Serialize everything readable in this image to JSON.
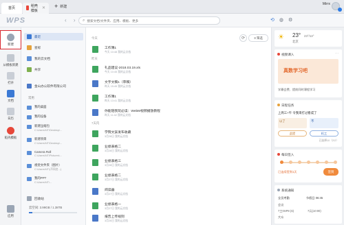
{
  "titlebar": {
    "tabs": [
      {
        "label": "首页"
      },
      {
        "label": "稻壳模板"
      }
    ],
    "new_tab": "新建",
    "user": "Mirrx"
  },
  "header": {
    "logo": "WPS",
    "search_placeholder": "搜索文档/文件夹、应用、模板、更多"
  },
  "rail": [
    {
      "label": "新建",
      "color": "#9aa5b4"
    },
    {
      "label": "从模板新建",
      "color": "#c2c8d0"
    },
    {
      "label": "打开",
      "color": "#c9ced6"
    },
    {
      "label": "文档",
      "color": "#3b79d4"
    },
    {
      "label": "日历",
      "color": "#c9ced6"
    },
    {
      "label": "稻壳模板",
      "color": "#e6473a"
    },
    {
      "label": "应用",
      "color": "#9aa5b4"
    }
  ],
  "sidebar": {
    "items": [
      {
        "label": "最近",
        "color": "#3b79d4"
      },
      {
        "label": "星标",
        "color": "#e6a23c"
      },
      {
        "label": "我的云文档",
        "color": "#5b8fd8"
      },
      {
        "label": "共享",
        "color": "#7fb04e"
      },
      {
        "label": "金山办公软件有限公司",
        "color": "#4a78c8"
      }
    ],
    "section_common": "常用",
    "common": [
      {
        "name": "我的桌面",
        "path": ""
      },
      {
        "name": "我的设备",
        "path": ""
      },
      {
        "name": "新建压缩包",
        "path": "C:\\Users\\NT\\Desktop\\..."
      },
      {
        "name": "新建项目",
        "path": "C:\\Users\\NT\\Desktop\\..."
      },
      {
        "name": "Camera Roll",
        "path": "C:\\Users\\NT\\Pictures\\..."
      },
      {
        "name": "视觉文件夹（图片）",
        "path": "C:\\Users\\NT\\(不同名...)"
      },
      {
        "name": "我的PPT",
        "path": "C:\\Users\\NT\\..."
      }
    ],
    "recycle": "回收站",
    "storage": "云空间: 3.99GB / 1.38TB"
  },
  "main": {
    "groups": [
      "今天",
      "昨天",
      "7天内"
    ],
    "filter_label": "筛选",
    "files": [
      {
        "name": "工作簿1",
        "meta": "今天 10:48   我的云文档",
        "color": "#3ea55e"
      },
      {
        "name": "礼品建议-2018.03.19.xls",
        "meta": "今天 10:45   我的云文档",
        "color": "#3ea55e"
      },
      {
        "name": "文字文稿1（草稿）",
        "meta": "昨天 15:45   我的云文档",
        "color": "#4a78c8"
      },
      {
        "name": "工作簿1",
        "meta": "昨天 13:41   我的云文档",
        "color": "#3ea55e"
      },
      {
        "name": "你能陪我玩必读：WebM视频播放教程",
        "meta": "昨天 11:42   我的云文档",
        "color": "#4a78c8"
      },
      {
        "name": "学院文案发布收藏",
        "meta": "3月28日   我的云文档",
        "color": "#3ea55e"
      },
      {
        "name": "业绩表格二",
        "meta": "3月28日   我的云文档",
        "color": "#3ea55e"
      },
      {
        "name": "业绩表格三",
        "meta": "3月28日   我的云文档",
        "color": "#3ea55e"
      },
      {
        "name": "业绩表格二",
        "meta": "3月27日   我的云文档",
        "color": "#3ea55e"
      },
      {
        "name": "阅读器",
        "meta": "3月27日   我的云文档",
        "color": "#4a78c8"
      },
      {
        "name": "业绩表格一",
        "meta": "3月27日   我的云文档",
        "color": "#3ea55e"
      },
      {
        "name": "报告上传规则",
        "meta": "3月26日   我的云文档",
        "color": "#4a78c8"
      },
      {
        "name": "示例文稿一/三",
        "meta": "3月26日   我的云文档",
        "color": "#4a78c8"
      }
    ]
  },
  "right": {
    "weather": {
      "temp": "23°",
      "range": "23°/13°",
      "city": "北京"
    },
    "card1": {
      "title": "视频课入",
      "banner": "真数学习吧",
      "text": "学最会费、提前同时课程学习"
    },
    "card2": {
      "title": "日程任务",
      "text": "上周三+午 令我来打过看成了",
      "opt1": "以了",
      "opt2": "不",
      "opt3": "此提",
      "opt4": "机工",
      "footer": "已选择10（2/2）"
    },
    "card3": {
      "title": "每日签入",
      "text": "已连续签到1天",
      "btn": "签到"
    },
    "card4": {
      "title": "系统通知",
      "time": "节假日 06:45",
      "row1": "全员考勤",
      "row2": "会议",
      "row3": "7工0SP8 (6)",
      "row4": "7元(10:00)",
      "row5": "大众"
    }
  }
}
